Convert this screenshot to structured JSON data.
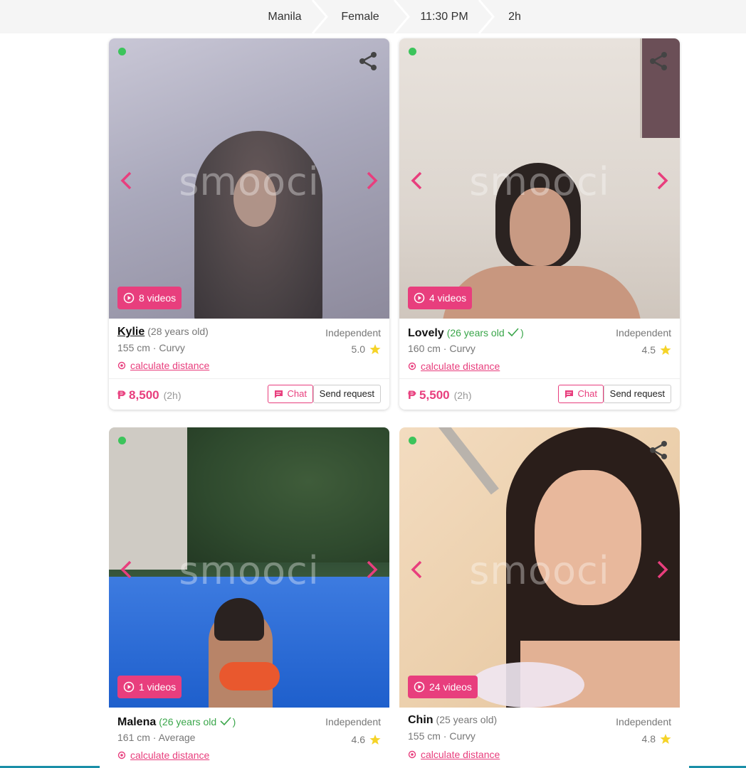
{
  "filters": {
    "location": "Manila",
    "gender": "Female",
    "time": "11:30 PM",
    "duration": "2h"
  },
  "watermark": "smooci",
  "cards": [
    {
      "name": "Kylie",
      "age": "(28 years old)",
      "height_build": "155 cm  ·  Curvy",
      "type": "Independent",
      "rating": "5.0",
      "distance_link": "calculate distance",
      "videos": "8 videos",
      "price": "₱ 8,500",
      "price_duration": "(2h)",
      "chat_label": "Chat",
      "request_label": "Send request"
    },
    {
      "name": "Lovely",
      "age": "(26 years old",
      "height_build": "160 cm  ·  Curvy",
      "type": "Independent",
      "rating": "4.5",
      "distance_link": "calculate distance",
      "videos": "4 videos",
      "price": "₱ 5,500",
      "price_duration": "(2h)",
      "chat_label": "Chat",
      "request_label": "Send request"
    },
    {
      "name": "Malena",
      "age": "(26 years old",
      "height_build": "161 cm  ·  Average",
      "type": "Independent",
      "rating": "4.6",
      "distance_link": "calculate distance",
      "videos": "1 videos"
    },
    {
      "name": "Chin",
      "age": "(25 years old)",
      "height_build": "155 cm  ·  Curvy",
      "type": "Independent",
      "rating": "4.8",
      "distance_link": "calculate distance",
      "videos": "24 videos"
    }
  ],
  "colors": {
    "accent": "#e83e7d",
    "online": "#3cc45b",
    "verified": "#3aa64a",
    "star": "#f5d328"
  }
}
